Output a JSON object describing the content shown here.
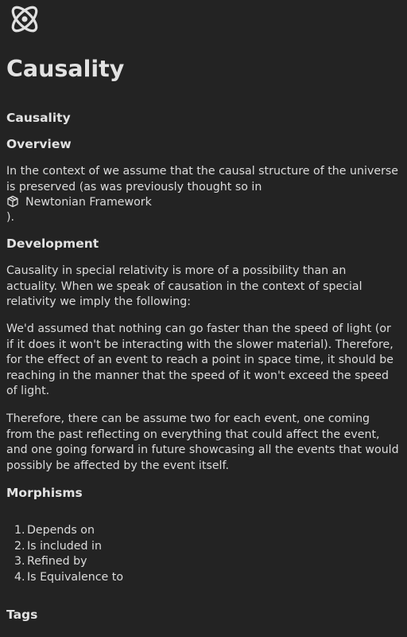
{
  "logo": {
    "icon": "atom-icon"
  },
  "title": "Causality",
  "subtitle": "Causality",
  "overview": {
    "heading": "Overview",
    "text_before": "In the context of we assume that the causal structure of the universe is preserved (as was previously thought so in",
    "link_icon": "cube-icon",
    "link_label": "Newtonian Framework",
    "text_after": ")."
  },
  "development": {
    "heading": "Development",
    "paragraphs": [
      "Causality in special relativity is more of a possibility than an actuality. When we speak of causation in the context of special relativity we imply the following:",
      "We'd assumed that nothing can go faster than the speed of light (or if it does it won't be interacting with the slower material). Therefore, for the effect of an event to reach a point in space time, it should be reaching in the manner that the speed of it won't exceed the speed of light.",
      "Therefore, there can be assume two for each event, one coming from the past reflecting on everything that could affect the event, and one going forward in future showcasing all the events that would possibly be affected by the event itself."
    ]
  },
  "morphisms": {
    "heading": "Morphisms",
    "items": [
      {
        "num": "1.",
        "label": "Depends on"
      },
      {
        "num": "2.",
        "label": "Is included in"
      },
      {
        "num": "3.",
        "label": "Refined by"
      },
      {
        "num": "4.",
        "label": "Is Equivalence to"
      }
    ]
  },
  "tags": {
    "heading": "Tags"
  }
}
